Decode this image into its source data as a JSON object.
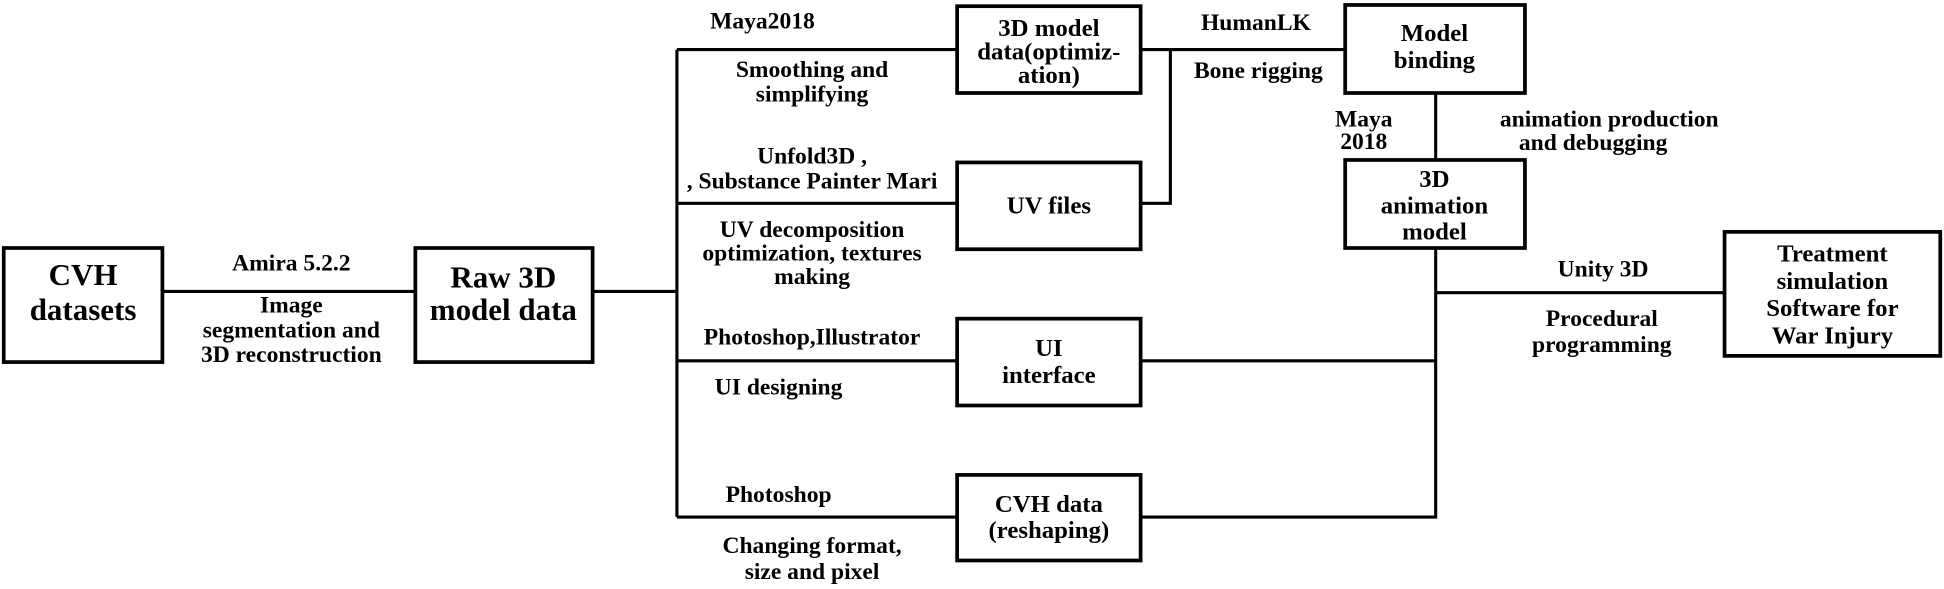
{
  "boxes": {
    "cvh_datasets": [
      "CVH",
      "datasets"
    ],
    "raw_model": [
      "Raw 3D",
      "model data"
    ],
    "model_optimization": [
      "3D model",
      "data(optimiz-",
      "ation)"
    ],
    "uv_files": [
      "UV files"
    ],
    "ui_interface": [
      "UI",
      "interface"
    ],
    "cvh_reshaping": [
      "CVH data",
      "(reshaping)"
    ],
    "model_binding": [
      "Model",
      "binding"
    ],
    "animation_model": [
      "3D",
      "animation",
      "model"
    ],
    "treatment_software": [
      "Treatment",
      "simulation",
      "Software for",
      "War Injury"
    ]
  },
  "edges": {
    "segmentation": {
      "tool": "Amira 5.2.2",
      "process": [
        "Image",
        "segmentation and",
        "3D reconstruction"
      ]
    },
    "smoothing": {
      "tool": "Maya2018",
      "process": [
        "Smoothing and",
        "simplifying"
      ]
    },
    "uv": {
      "tool": [
        "Unfold3D ,",
        ", Substance Painter Mari"
      ],
      "process": [
        "UV decomposition",
        "optimization, textures",
        "making"
      ]
    },
    "ui": {
      "tool": "Photoshop,Illustrator",
      "process": "UI designing"
    },
    "reshaping": {
      "tool": "Photoshop",
      "process": [
        "Changing format,",
        "size and pixel"
      ]
    },
    "rigging": {
      "tool": "HumanLK",
      "process": "Bone rigging"
    },
    "animation": {
      "tool": [
        "Maya",
        "2018"
      ],
      "process": [
        "animation production",
        "and debugging"
      ]
    },
    "programming": {
      "tool": "Unity 3D",
      "process": [
        "Procedural",
        "programming"
      ]
    }
  }
}
